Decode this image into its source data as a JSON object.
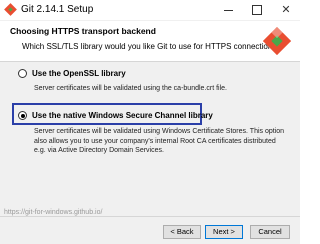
{
  "window": {
    "title": "Git 2.14.1 Setup",
    "minimize_icon": "minimize-icon",
    "maximize_icon": "maximize-icon",
    "close_glyph": "✕"
  },
  "header": {
    "title": "Choosing HTTPS transport backend",
    "subtitle": "Which SSL/TLS library would you like Git to use for HTTPS connections?",
    "logo_icon": "git-logo-icon"
  },
  "options": [
    {
      "label": "Use the OpenSSL library",
      "description": "Server certificates will be validated using the ca-bundle.crt file.",
      "selected": false
    },
    {
      "label": "Use the native Windows Secure Channel library",
      "description": "Server certificates will be validated using Windows Certificate Stores. This option also allows you to use your company's internal Root CA certificates distributed e.g. via Active Directory Domain Services.",
      "selected": true
    }
  ],
  "footer": {
    "link": "https://git-for-windows.github.io/",
    "back_label": "< Back",
    "next_label": "Next >",
    "cancel_label": "Cancel"
  },
  "colors": {
    "highlight_border": "#2b3fa8",
    "content_bg": "#f0f0f0",
    "logo_red": "#e94e31",
    "logo_green": "#4aa84a"
  }
}
